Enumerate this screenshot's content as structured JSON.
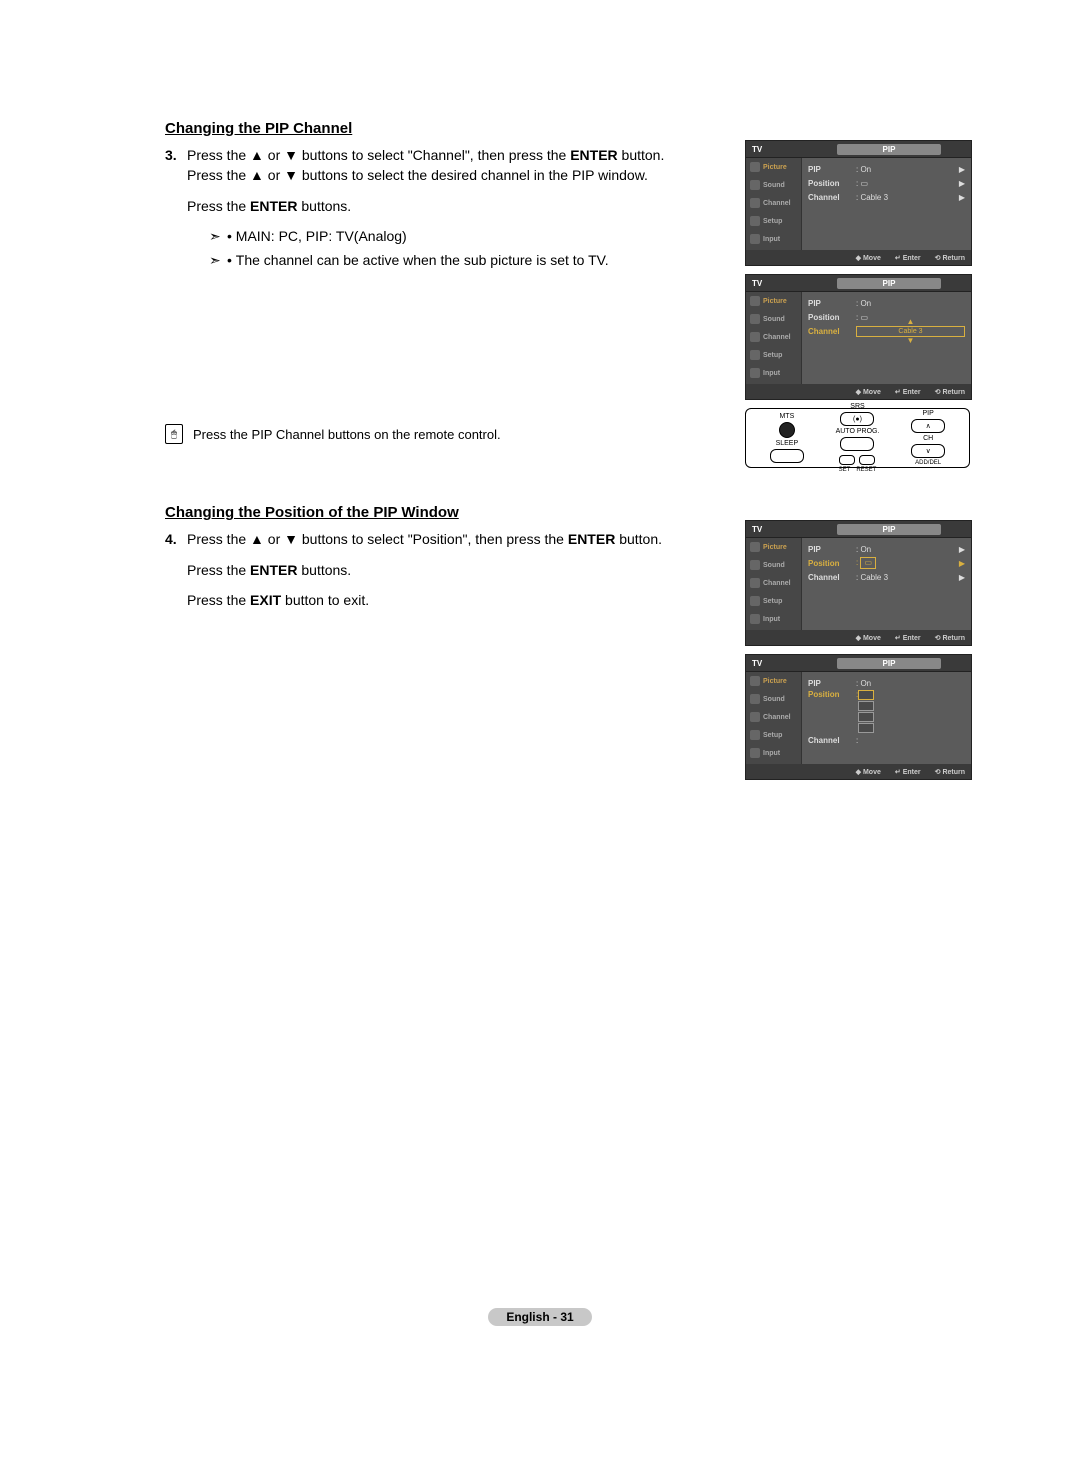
{
  "section1": {
    "title": "Changing the PIP Channel",
    "step_num": "3.",
    "line1a": "Press the ",
    "line1b": " or ",
    "line1c": " buttons to select \"Channel\", then press the ",
    "line1d": " button.",
    "line2a": "Press the ",
    "line2b": " or ",
    "line2c": " buttons to select the desired channel in the PIP window.",
    "line3a": "Press the ",
    "line3b": " buttons.",
    "note1": "MAIN: PC,  PIP: TV(Analog)",
    "note2": "The channel can be active when the sub picture is set to TV.",
    "remote_hint": "Press the PIP Channel buttons on the remote control.",
    "enter": "ENTER",
    "up": "▲",
    "down": "▼",
    "bullet": "•",
    "arrow": "➣"
  },
  "section2": {
    "title": "Changing the Position of the PIP Window",
    "step_num": "4.",
    "line1a": "Press the ",
    "line1b": " or ",
    "line1c": " buttons to select \"Position\", then press the ",
    "line1d": " button.",
    "line2a": "Press the ",
    "line2b": " buttons.",
    "line3a": "Press the ",
    "line3b": " button to exit.",
    "enter": "ENTER",
    "exit": "EXIT",
    "up": "▲",
    "down": "▼"
  },
  "tv_menu": {
    "tv": "TV",
    "pip_tab": "PIP",
    "sidebar": [
      "Picture",
      "Sound",
      "Channel",
      "Setup",
      "Input"
    ],
    "rows": {
      "pip": "PIP",
      "position": "Position",
      "channel": "Channel",
      "on": ": On",
      "colon": ":",
      "cable3": ": Cable 3",
      "cable3_plain": "Cable 3",
      "arrow": "▶"
    },
    "footer": {
      "move": "Move",
      "enter": "Enter",
      "return": "Return",
      "move_sym": "◆",
      "enter_sym": "↵",
      "return_sym": "⟲"
    }
  },
  "remote": {
    "labels": [
      "MTS",
      "SRS",
      "PIP",
      "SLEEP",
      "AUTO PROG.",
      "ADD/DEL",
      "CH",
      "SET",
      "RESET"
    ],
    "up": "∧",
    "down": "∨"
  },
  "footer": {
    "text": "English - 31"
  }
}
